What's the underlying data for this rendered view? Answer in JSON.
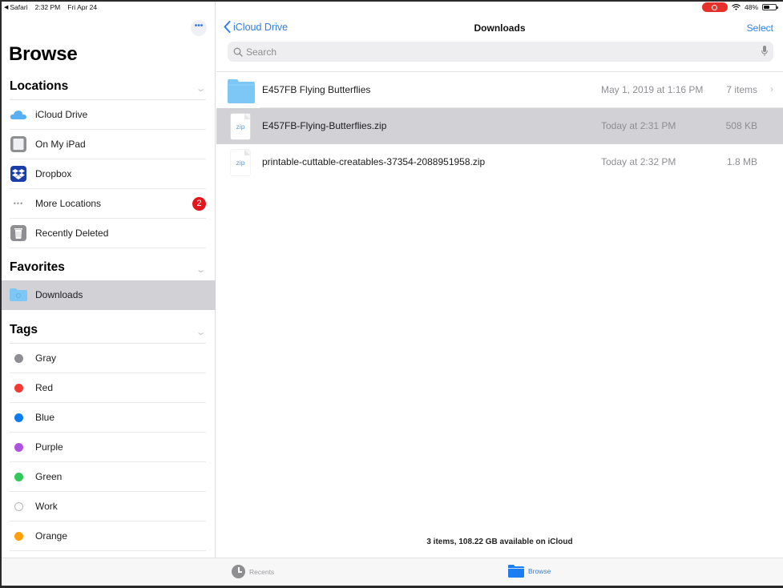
{
  "status_bar": {
    "back_app": "Safari",
    "time": "2:32 PM",
    "date": "Fri Apr 24",
    "battery_percent_label": "48%",
    "battery_level": 0.48,
    "recording": true
  },
  "sidebar": {
    "title": "Browse",
    "more_button_label": "•••",
    "sections": {
      "locations": {
        "title": "Locations",
        "items": [
          {
            "label": "iCloud Drive",
            "icon": "icloud-icon"
          },
          {
            "label": "On My iPad",
            "icon": "ipad-icon"
          },
          {
            "label": "Dropbox",
            "icon": "dropbox-icon"
          },
          {
            "label": "More Locations",
            "icon": "ellipsis-icon",
            "badge": "2"
          },
          {
            "label": "Recently Deleted",
            "icon": "trash-icon"
          }
        ]
      },
      "favorites": {
        "title": "Favorites",
        "items": [
          {
            "label": "Downloads",
            "icon": "downloads-folder-icon",
            "selected": true
          }
        ]
      },
      "tags": {
        "title": "Tags",
        "items": [
          {
            "label": "Gray",
            "color": "#8e8e93"
          },
          {
            "label": "Red",
            "color": "#f23a33"
          },
          {
            "label": "Blue",
            "color": "#0a7cf0"
          },
          {
            "label": "Purple",
            "color": "#af52de"
          },
          {
            "label": "Green",
            "color": "#34c759"
          },
          {
            "label": "Work",
            "color": "#ffffff"
          },
          {
            "label": "Orange",
            "color": "#ff9f0a"
          }
        ]
      }
    }
  },
  "main": {
    "nav": {
      "back_label": "iCloud Drive",
      "title": "Downloads",
      "select_label": "Select"
    },
    "search": {
      "placeholder": "Search"
    },
    "files": [
      {
        "name": "E457FB Flying Butterflies",
        "type": "folder",
        "date": "May 1, 2019 at 1:16 PM",
        "size": "7 items",
        "has_chevron": true,
        "selected": false
      },
      {
        "name": "E457FB-Flying-Butterflies.zip",
        "type": "zip",
        "type_label": "zip",
        "date": "Today at 2:31 PM",
        "size": "508 KB",
        "selected": true
      },
      {
        "name": "printable-cuttable-creatables-37354-2088951958.zip",
        "type": "zip",
        "type_label": "zip",
        "date": "Today at 2:32 PM",
        "size": "1.8 MB",
        "selected": false
      }
    ],
    "footer_status": "3 items, 108.22 GB available on iCloud"
  },
  "tab_bar": {
    "tabs": [
      {
        "label": "Recents",
        "icon": "clock-icon",
        "active": false
      },
      {
        "label": "Browse",
        "icon": "folder-icon",
        "active": true
      }
    ]
  },
  "colors": {
    "accent": "#2f7ee0",
    "selection": "#d1d1d6",
    "badge": "#e4151b",
    "folder": "#7cc7f5"
  }
}
